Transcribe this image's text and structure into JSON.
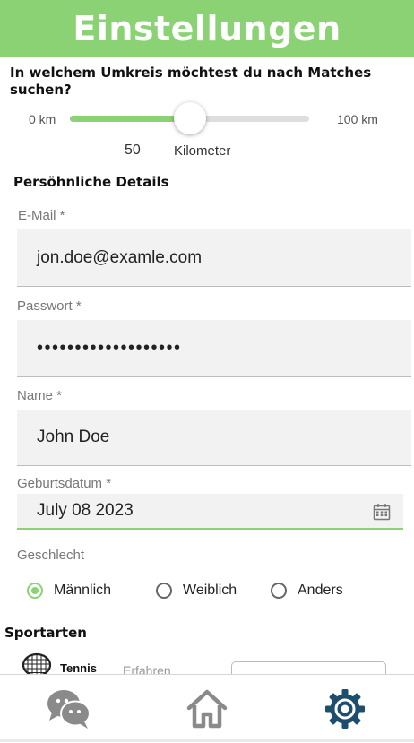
{
  "header": {
    "title": "Einstellungen"
  },
  "radius": {
    "question": "In welchem Umkreis möchtest du nach Matches suchen?",
    "min_label": "0 km",
    "max_label": "100 km",
    "min": 0,
    "max": 100,
    "value": 50,
    "value_text": "50",
    "unit_label": "Kilometer"
  },
  "personal": {
    "title": "Persöhnliche Details",
    "email": {
      "label": "E-Mail *",
      "value": "jon.doe@examle.com"
    },
    "password": {
      "label": "Passwort *",
      "value": "•••••••••••••••••••"
    },
    "name": {
      "label": "Name *",
      "value": "John Doe"
    },
    "birthdate": {
      "label": "Geburtsdatum *",
      "value": "July 08 2023",
      "icon": "calendar-icon"
    },
    "gender": {
      "label": "Geschlecht",
      "options": [
        {
          "label": "Männlich",
          "checked": true
        },
        {
          "label": "Weiblich",
          "checked": false
        },
        {
          "label": "Anders",
          "checked": false
        }
      ]
    }
  },
  "sports": {
    "title": "Sportarten",
    "items": [
      {
        "name": "Tennis",
        "icon": "tennis-racket-icon",
        "experience_label": "Erfahren"
      }
    ]
  },
  "nav": {
    "items": [
      {
        "icon": "chat-icon"
      },
      {
        "icon": "home-icon"
      },
      {
        "icon": "gear-icon",
        "active": true
      }
    ]
  },
  "colors": {
    "accent": "#8bd274",
    "nav_icon": "#888888",
    "nav_active": "#1e4e6e"
  }
}
